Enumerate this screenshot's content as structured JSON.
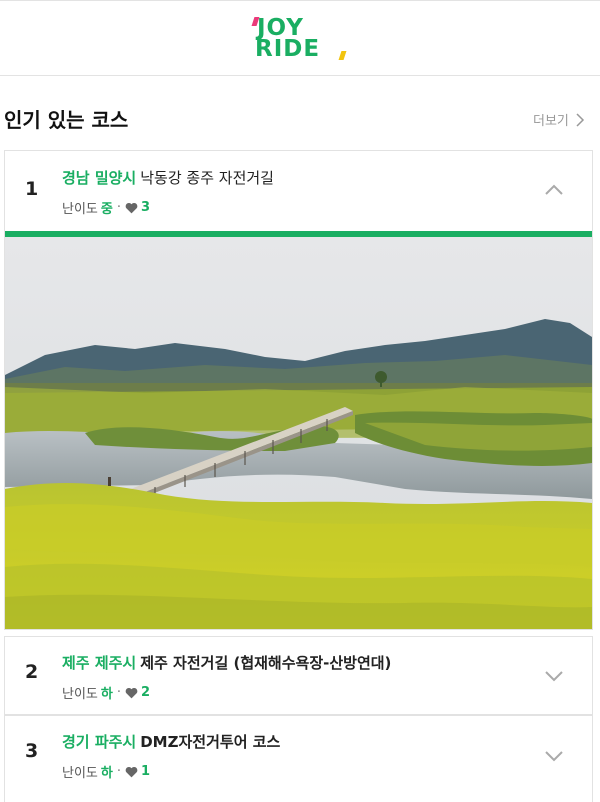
{
  "header": {
    "logo_line1": "JOY",
    "logo_line2": "RIDE",
    "brand_color": "#1aae62"
  },
  "section": {
    "title": "인기 있는 코스",
    "more_label": "더보기"
  },
  "courses": [
    {
      "rank": "1",
      "region": "경남 밀양시",
      "name": "낙동강 종주 자전거길",
      "difficulty_label": "난이도",
      "difficulty": "중",
      "likes": "3",
      "expanded": true,
      "image": "river-boardwalk-canola-field-photo"
    },
    {
      "rank": "2",
      "region": "제주 제주시",
      "name": "제주 자전거길 (협재해수욕장-산방연대)",
      "difficulty_label": "난이도",
      "difficulty": "하",
      "likes": "2",
      "expanded": false
    },
    {
      "rank": "3",
      "region": "경기 파주시",
      "name": "DMZ자전거투어 코스",
      "difficulty_label": "난이도",
      "difficulty": "하",
      "likes": "1",
      "expanded": false
    }
  ],
  "icons": {
    "more": "chevron-right-icon",
    "like": "heart-icon",
    "collapse": "chevron-up-icon",
    "expand": "chevron-down-icon"
  }
}
